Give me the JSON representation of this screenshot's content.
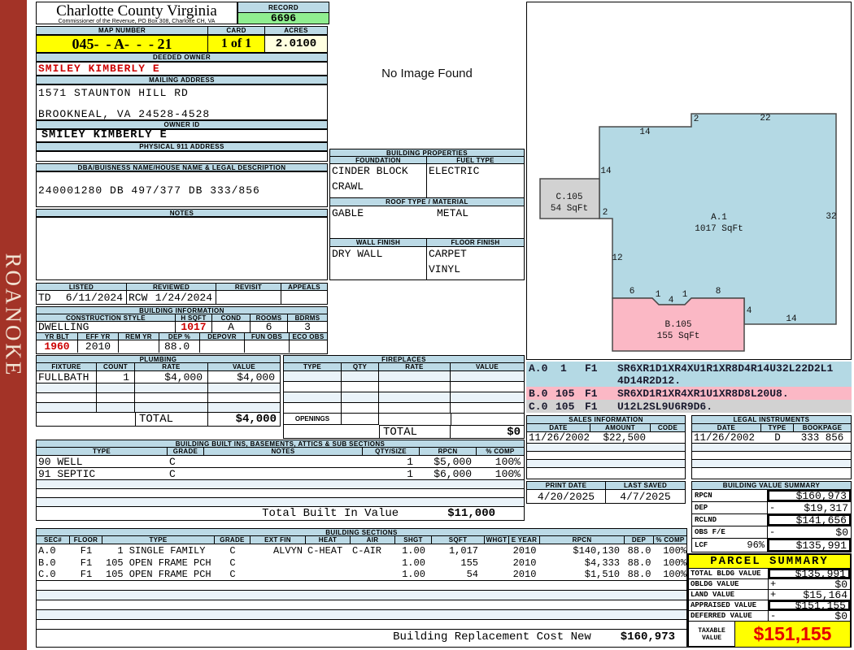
{
  "header": {
    "county": "Charlotte County Virginia",
    "subtitle": "Commissioner of the Revenue, PO Box 308, Charlotte CH, VA",
    "record_label": "RECORD",
    "record_value": "6696",
    "map_label": "MAP NUMBER",
    "map_value": "045-  - A-  -  - 21",
    "card_label": "CARD",
    "card_value": "1 of 1",
    "acres_label": "ACRES",
    "acres_value": "2.0100"
  },
  "sidebar": {
    "text": "ROANOKE"
  },
  "owner": {
    "deeded_label": "DEEDED OWNER",
    "deeded": "SMILEY KIMBERLY E",
    "mailing_label": "MAILING ADDRESS",
    "addr1": "1571 STAUNTON HILL RD",
    "addr2": "BROOKNEAL, VA 24528-4528",
    "ownerid_label": "OWNER ID",
    "ownerid": "SMILEY KIMBERLY E",
    "physical_label": "PHYSICAL 911 ADDRESS",
    "dba_label": "DBA/BUISNESS NAME/HOUSE NAME & LEGAL DESCRIPTION",
    "dba": "240001280 DB 497/377 DB 333/856",
    "notes_label": "NOTES"
  },
  "visits": {
    "listed_label": "LISTED",
    "listed_by": "TD",
    "listed_date": "6/11/2024",
    "reviewed_label": "REVIEWED",
    "reviewed_by": "RCW",
    "reviewed_date": "1/24/2024",
    "revisit_label": "REVISIT",
    "appeals_label": "APPEALS"
  },
  "building_info": {
    "title": "BUILDING INFORMATION",
    "style_label": "CONSTRUCTION STYLE",
    "style": "DWELLING",
    "hsqft_label": "H SQFT",
    "hsqft": "1017",
    "cond_label": "COND",
    "cond": "A",
    "rooms_label": "ROOMS",
    "rooms": "6",
    "bdrms_label": "BDRMS",
    "bdrms": "3",
    "yrblt_label": "YR BLT",
    "yrblt": "1960",
    "effyr_label": "EFF YR",
    "effyr": "2010",
    "remyr_label": "REM YR",
    "dep_label": "DEP %",
    "dep": "88.0",
    "depovr_label": "DEPOVR",
    "funobs_label": "FUN OBS",
    "ecoobs_label": "ECO OBS"
  },
  "plumbing": {
    "title": "PLUMBING",
    "h": {
      "fixture": "FIXTURE",
      "count": "COUNT",
      "rate": "RATE",
      "value": "VALUE"
    },
    "rows": [
      {
        "fixture": "FULLBATH",
        "count": "1",
        "rate": "$4,000",
        "value": "$4,000"
      }
    ],
    "total_label": "TOTAL",
    "total": "$4,000"
  },
  "fireplaces": {
    "title": "FIREPLACES",
    "h": {
      "type": "TYPE",
      "qty": "QTY",
      "rate": "RATE",
      "value": "VALUE"
    },
    "openings_label": "OPENINGS",
    "total_label": "TOTAL",
    "total": "$0"
  },
  "builtins": {
    "title": "BUILDING BUILT INS, BASEMENTS, ATTICS & SUB SECTIONS",
    "h": {
      "type": "TYPE",
      "grade": "GRADE",
      "notes": "NOTES",
      "qty": "QTY/SIZE",
      "rpcn": "RPCN",
      "comp": "% COMP"
    },
    "rows": [
      {
        "type": "90 WELL",
        "grade": "C",
        "notes": "",
        "qty": "1",
        "rpcn": "$5,000",
        "comp": "100%"
      },
      {
        "type": "91 SEPTIC",
        "grade": "C",
        "notes": "",
        "qty": "1",
        "rpcn": "$6,000",
        "comp": "100%"
      }
    ],
    "total_label": "Total Built In Value",
    "total": "$11,000"
  },
  "sections": {
    "title": "BUILDING SECTIONS",
    "h": {
      "sec": "SEC#",
      "floor": "FLOOR",
      "type": "TYPE",
      "grade": "GRADE",
      "extfin": "EXT FIN",
      "heat": "HEAT",
      "air": "AIR",
      "shgt": "SHGT",
      "sqft": "SQFT",
      "whgt": "WHGT",
      "eyear": "E YEAR",
      "rpcn": "RPCN",
      "dep": "DEP",
      "comp": "% COMP"
    },
    "rows": [
      {
        "sec": "A.0",
        "floor": "F1",
        "type": "  1 SINGLE FAMILY",
        "grade": "C",
        "extfin": "ALVYN",
        "heat": "C-HEAT",
        "air": "C-AIR",
        "shgt": "1.00",
        "sqft": "1,017",
        "whgt": "",
        "eyear": "2010",
        "rpcn": "$140,130",
        "dep": "88.0",
        "comp": "100%"
      },
      {
        "sec": "B.0",
        "floor": "F1",
        "type": "105 OPEN FRAME PCH",
        "grade": "C",
        "extfin": "",
        "heat": "",
        "air": "",
        "shgt": "1.00",
        "sqft": "155",
        "whgt": "",
        "eyear": "2010",
        "rpcn": "$4,333",
        "dep": "88.0",
        "comp": "100%"
      },
      {
        "sec": "C.0",
        "floor": "F1",
        "type": "105 OPEN FRAME PCH",
        "grade": "C",
        "extfin": "",
        "heat": "",
        "air": "",
        "shgt": "1.00",
        "sqft": "54",
        "whgt": "",
        "eyear": "2010",
        "rpcn": "$1,510",
        "dep": "88.0",
        "comp": "100%"
      }
    ],
    "footer_label": "Building Replacement Cost New",
    "footer_value": "$160,973"
  },
  "properties": {
    "title": "BUILDING PROPERTIES",
    "foundation_label": "FOUNDATION",
    "fuel_label": "FUEL TYPE",
    "foundation1": "CINDER BLOCK",
    "foundation2": "CRAWL",
    "fuel": "ELECTRIC",
    "roof_label": "ROOF TYPE / MATERIAL",
    "roof_type": "GABLE",
    "roof_material": "METAL",
    "wall_label": "WALL FINISH",
    "floor_label": "FLOOR FINISH",
    "wall": "DRY WALL",
    "floor1": "CARPET",
    "floor2": "VINYL"
  },
  "no_image": "No Image Found",
  "sketch": {
    "regions": [
      {
        "name": "A.1",
        "sqft": "1017 SqFt"
      },
      {
        "name": "B.105",
        "sqft": "155 SqFt"
      },
      {
        "name": "C.105",
        "sqft": "54 SqFt"
      }
    ],
    "dims": [
      "2",
      "22",
      "14",
      "14",
      "2",
      "32",
      "12",
      "6",
      "1",
      "4",
      "1",
      "8",
      "4",
      "14"
    ],
    "vectors": [
      {
        "sec": "A.0",
        "mult": "1",
        "floor": "F1",
        "line1": "SR6XR1D1XR4XU1R1XR8D4R14U32L22D2L1",
        "line2": "4D14R2D12."
      },
      {
        "sec": "B.0",
        "mult": "105",
        "floor": "F1",
        "line1": "SR6XD1R1XR4XR1U1XR8D8L20U8.",
        "line2": ""
      },
      {
        "sec": "C.0",
        "mult": "105",
        "floor": "F1",
        "line1": "U12L2SL9U6R9D6.",
        "line2": ""
      }
    ]
  },
  "sales": {
    "title": "SALES INFORMATION",
    "h": {
      "date": "DATE",
      "amount": "AMOUNT",
      "code": "CODE"
    },
    "rows": [
      {
        "date": "11/26/2002",
        "amount": "$22,500",
        "code": ""
      }
    ]
  },
  "legal": {
    "title": "LEGAL INSTRUMENTS",
    "h": {
      "date": "DATE",
      "type": "TYPE",
      "book": "BOOKPAGE"
    },
    "rows": [
      {
        "date": "11/26/2002",
        "type": "D",
        "book": "333 856"
      }
    ]
  },
  "print_info": {
    "print_label": "PRINT DATE",
    "print_value": "4/20/2025",
    "saved_label": "LAST SAVED",
    "saved_value": "4/7/2025"
  },
  "value_summary": {
    "title": "BUILDING VALUE SUMMARY",
    "rows": [
      {
        "label": "RPCN",
        "pct": "",
        "sign": "",
        "value": "$160,973"
      },
      {
        "label": "DEP",
        "pct": "",
        "sign": "-",
        "value": "$19,317"
      },
      {
        "label": "RCLND",
        "pct": "",
        "sign": "",
        "value": "$141,656"
      },
      {
        "label": "OBS F/E",
        "pct": "",
        "sign": "-",
        "value": "$0"
      },
      {
        "label": "LCF",
        "pct": "96%",
        "sign": "",
        "value": "$135,991"
      }
    ]
  },
  "parcel": {
    "title": "PARCEL SUMMARY",
    "rows": [
      {
        "label": "TOTAL BLDG VALUE",
        "sign": "",
        "value": "$135,991"
      },
      {
        "label": "OBLDG VALUE",
        "sign": "+",
        "value": "$0"
      },
      {
        "label": "LAND VALUE",
        "sign": "+",
        "value": "$15,164"
      },
      {
        "label": "APPRAISED VALUE",
        "sign": "",
        "value": "$151,155"
      },
      {
        "label": "DEFERRED VALUE",
        "sign": "-",
        "value": "$0"
      }
    ],
    "taxable_label1": "TAXABLE",
    "taxable_label2": "VALUE",
    "taxable": "$151,155"
  },
  "colors": {
    "sidebar_red": "#A33327",
    "bar_blue": "#BCDAE6",
    "record_green": "#90EE90",
    "highlight_yellow": "#FFFF00",
    "acres_cream": "#FFFFE0",
    "accent_red": "#CC0000",
    "taxable_red": "#E60000",
    "sketch_blue": "#B4D9E4",
    "sketch_pink": "#FBB8C5",
    "sketch_gray": "#D2D2D2"
  }
}
